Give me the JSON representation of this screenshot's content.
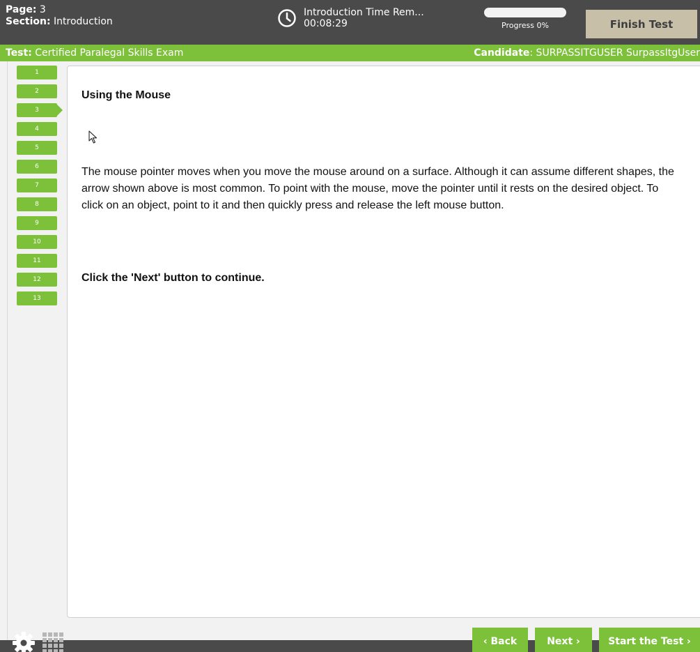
{
  "header": {
    "page_label": "Page:",
    "page_value": "3",
    "section_label": "Section:",
    "section_value": "Introduction",
    "timer_title": "Introduction Time Rem...",
    "timer_value": "00:08:29",
    "progress_label": "Progress 0%",
    "progress_fraction": 0,
    "finish_label": "Finish Test"
  },
  "infobar": {
    "test_label": "Test:",
    "test_value": "Certified Paralegal Skills Exam",
    "candidate_label": "Candidate",
    "candidate_value": ": SURPASSITGUSER SurpassItgUser"
  },
  "questions": [
    "1",
    "2",
    "3",
    "4",
    "5",
    "6",
    "7",
    "8",
    "9",
    "10",
    "11",
    "12",
    "13"
  ],
  "current_question": 3,
  "content": {
    "heading": "Using the Mouse",
    "body": "The mouse pointer moves when you move the mouse around on a surface. Although it can assume different shapes, the arrow shown above is most common. To point with the mouse, move the pointer until it rests on the desired object. To click on an object, point to it and then quickly press and release the left mouse button.",
    "cta": "Click the 'Next' button to continue."
  },
  "footer": {
    "back_label": "‹ Back",
    "next_label": "Next ›",
    "start_label": "Start the Test ›"
  },
  "colors": {
    "accent": "#7dc13a",
    "header_bg": "#4a4a4a",
    "finish_bg": "#c8bfa9"
  }
}
